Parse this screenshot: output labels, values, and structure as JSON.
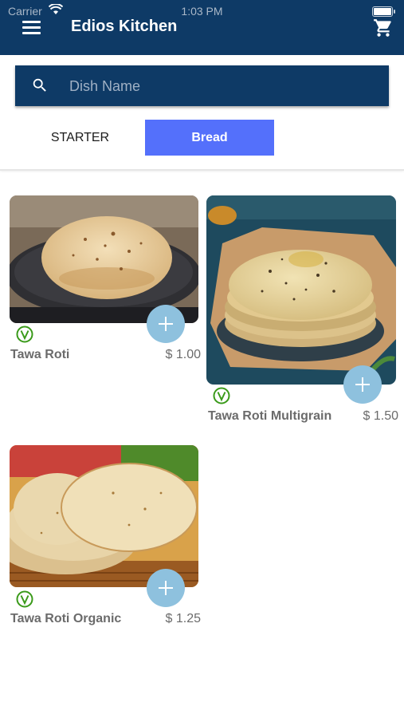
{
  "status_bar": {
    "carrier": "Carrier",
    "time": "1:03 PM"
  },
  "header": {
    "title": "Edios Kitchen",
    "menu_icon": "hamburger-menu-icon",
    "cart_icon": "shopping-cart-icon"
  },
  "search": {
    "placeholder": "Dish Name",
    "value": "",
    "icon": "search-icon"
  },
  "tabs": [
    {
      "label": "STARTER",
      "active": false
    },
    {
      "label": "Bread",
      "active": true
    }
  ],
  "colors": {
    "primary": "#0e3a66",
    "active_tab": "#5470fb",
    "add_button": "#8ec1de",
    "veg_icon": "#3a9a1a"
  },
  "dishes": [
    {
      "name": "Tawa Roti",
      "price": "$ 1.00",
      "veg": true
    },
    {
      "name": "Tawa Roti Multigrain",
      "price": "$ 1.50",
      "veg": true
    },
    {
      "name": "Tawa Roti Organic",
      "price": "$ 1.25",
      "veg": true
    }
  ]
}
